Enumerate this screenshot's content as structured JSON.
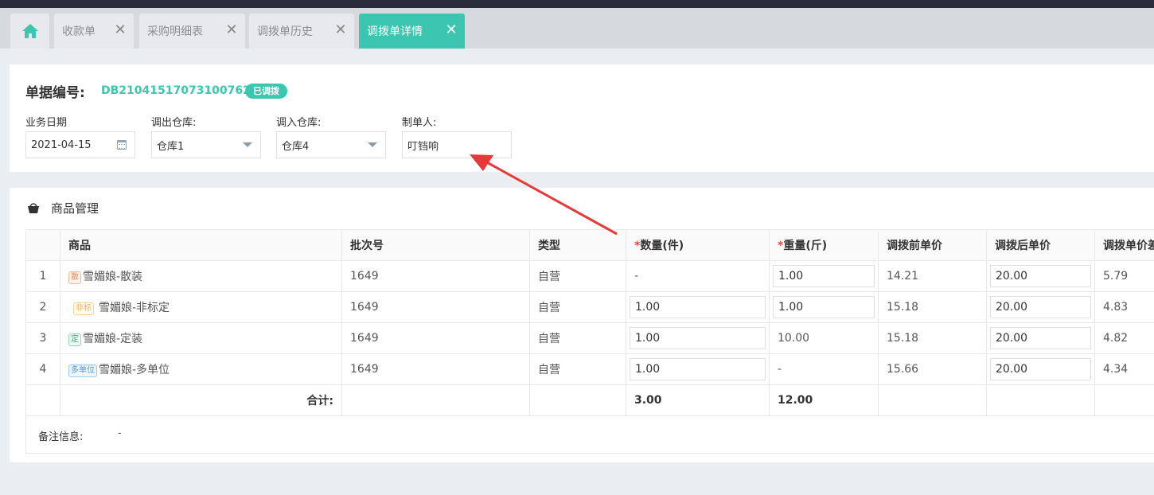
{
  "tabs": [
    {
      "label": "收款单"
    },
    {
      "label": "采购明细表"
    },
    {
      "label": "调拨单历史"
    },
    {
      "label": "调拨单详情"
    }
  ],
  "doc": {
    "label": "单据编号:",
    "number": "DB210415170731007626",
    "status": "已调拨"
  },
  "fields": {
    "date_label": "业务日期",
    "date_value": "2021-04-15",
    "out_label": "调出仓库:",
    "out_value": "仓库1",
    "in_label": "调入仓库:",
    "in_value": "仓库4",
    "maker_label": "制单人:",
    "maker_value": "叮铛响"
  },
  "section": {
    "title": "商品管理"
  },
  "table": {
    "headers": {
      "product": "商品",
      "batch": "批次号",
      "type": "类型",
      "qty": "数量(件)",
      "weight": "重量(斤)",
      "price_before": "调拨前单价",
      "price_after": "调拨后单价",
      "price_diff": "调拨单价差"
    },
    "rows": [
      {
        "idx": "1",
        "tag": "散",
        "name": "雪媚娘-散装",
        "batch": "1649",
        "type": "自营",
        "qty": "-",
        "weight": "1.00",
        "price_before": "14.21",
        "price_after": "20.00",
        "price_diff": "5.79"
      },
      {
        "idx": "2",
        "tag": "非标",
        "name": "雪媚娘-非标定",
        "batch": "1649",
        "type": "自营",
        "qty": "1.00",
        "weight": "1.00",
        "price_before": "15.18",
        "price_after": "20.00",
        "price_diff": "4.83"
      },
      {
        "idx": "3",
        "tag": "定",
        "name": "雪媚娘-定装",
        "batch": "1649",
        "type": "自营",
        "qty": "1.00",
        "weight": "10.00",
        "price_before": "15.18",
        "price_after": "20.00",
        "price_diff": "4.82"
      },
      {
        "idx": "4",
        "tag": "多单位",
        "name": "雪媚娘-多单位",
        "batch": "1649",
        "type": "自营",
        "qty": "1.00",
        "weight": "-",
        "price_before": "15.66",
        "price_after": "20.00",
        "price_diff": "4.34"
      }
    ],
    "total": {
      "label": "合计:",
      "qty": "3.00",
      "weight": "12.00"
    }
  },
  "remark": {
    "label": "备注信息:",
    "value": "-"
  },
  "colors": {
    "accent": "#3cc6b0",
    "arrow": "#e8393a",
    "required": "#e04c4c"
  }
}
